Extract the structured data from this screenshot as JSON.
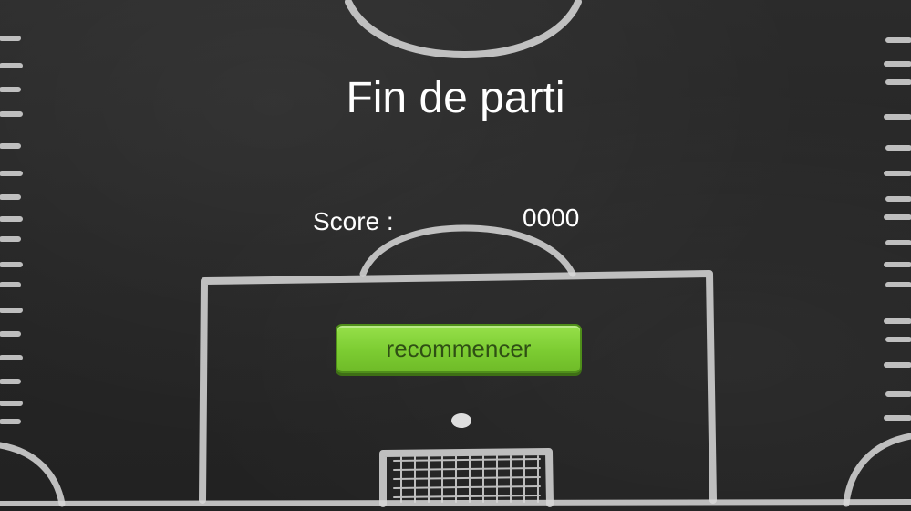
{
  "game_over": {
    "title": "Fin de parti",
    "score_label": "Score :",
    "score_value": "0000",
    "restart_label": "recommencer"
  },
  "colors": {
    "board": "#262626",
    "chalk": "#d9d9d9",
    "button": "#7ccc32",
    "button_text": "#2f4f14",
    "text": "#ffffff"
  }
}
